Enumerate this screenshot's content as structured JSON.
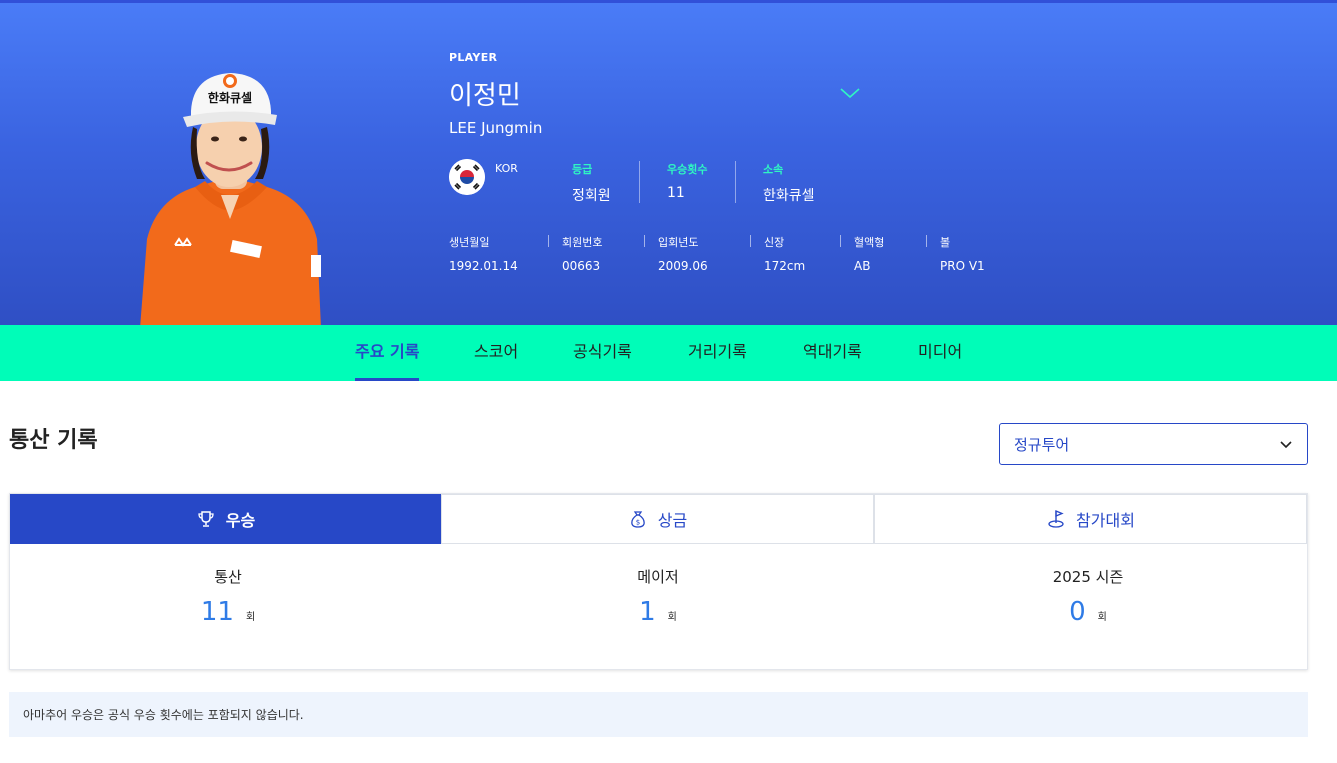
{
  "player": {
    "eyebrow": "PLAYER",
    "name_ko": "이정민",
    "name_en": "LEE Jungmin",
    "nation": "KOR",
    "cap_text": "한화큐셀",
    "stats": [
      {
        "label": "등급",
        "value": "정회원"
      },
      {
        "label": "우승횟수",
        "value": "11"
      },
      {
        "label": "소속",
        "value": "한화큐셀"
      }
    ],
    "details": [
      {
        "label": "생년월일",
        "value": "1992.01.14"
      },
      {
        "label": "회원번호",
        "value": "00663"
      },
      {
        "label": "입회년도",
        "value": "2009.06"
      },
      {
        "label": "신장",
        "value": "172cm"
      },
      {
        "label": "혈액형",
        "value": "AB"
      },
      {
        "label": "볼",
        "value": "PRO V1"
      }
    ]
  },
  "tabs": [
    "주요 기록",
    "스코어",
    "공식기록",
    "거리기록",
    "역대기록",
    "미디어"
  ],
  "active_tab": "주요 기록",
  "section": {
    "title": "통산 기록",
    "tour_select": "정규투어"
  },
  "card_tabs": [
    {
      "label": "우승",
      "icon": "trophy-icon"
    },
    {
      "label": "상금",
      "icon": "money-bag-icon"
    },
    {
      "label": "참가대회",
      "icon": "golf-flag-icon"
    }
  ],
  "win_stats": [
    {
      "label": "통산",
      "value": "11",
      "unit": "회"
    },
    {
      "label": "메이저",
      "value": "1",
      "unit": "회"
    },
    {
      "label": "2025 시즌",
      "value": "0",
      "unit": "회"
    }
  ],
  "notice": "아마추어 우승은 공식 우승 횟수에는 포함되지 않습니다.",
  "colors": {
    "hero_top": "#4a7cf7",
    "hero_bottom": "#2f4fc4",
    "tab_bar": "#00fdb8",
    "accent": "#2748c7",
    "stat_label": "#2ff5c3",
    "number": "#2f7be6",
    "shirt": "#f26a1b"
  }
}
